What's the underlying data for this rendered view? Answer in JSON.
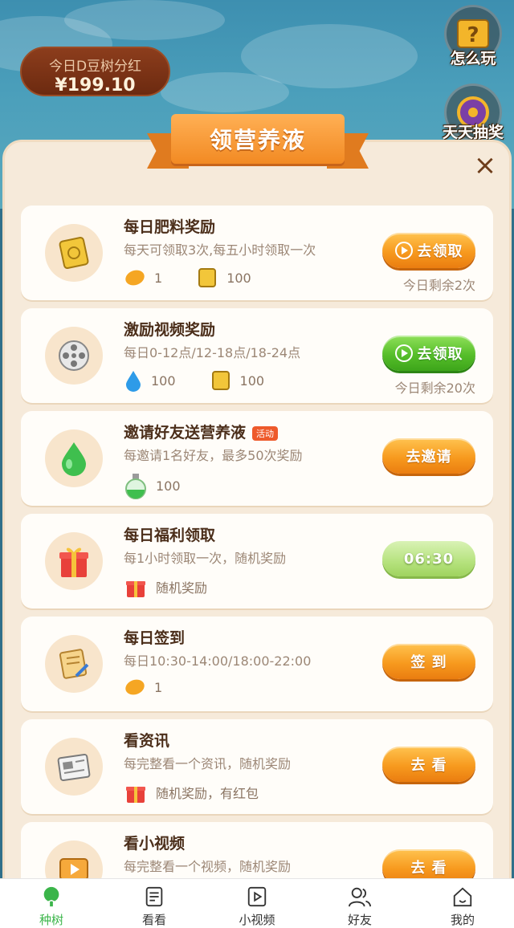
{
  "header": {
    "dividend_label": "今日D豆树分红",
    "dividend_amount": "¥199.10",
    "how_to_play": "怎么玩",
    "daily_lottery": "天天抽奖"
  },
  "panel": {
    "title": "领营养液",
    "close_icon": "×"
  },
  "tasks": [
    {
      "title": "每日肥料奖励",
      "desc": "每天可领取3次,每五小时领取一次",
      "rewards": [
        {
          "icon": "bean-icon",
          "value": "1"
        },
        {
          "icon": "fertilizer-bag-icon",
          "value": "100"
        }
      ],
      "button": "去领取",
      "button_style": "orange-play",
      "remain": "今日剩余2次"
    },
    {
      "title": "激励视频奖励",
      "desc": "每日0-12点/12-18点/18-24点",
      "rewards": [
        {
          "icon": "water-drop-icon",
          "value": "100"
        },
        {
          "icon": "fertilizer-bag-icon",
          "value": "100"
        }
      ],
      "button": "去领取",
      "button_style": "green-play",
      "remain": "今日剩余20次"
    },
    {
      "title": "邀请好友送营养液",
      "tag": "活动",
      "desc": "每邀请1名好友，最多50次奖励",
      "rewards": [
        {
          "icon": "nutrient-bottle-icon",
          "value": "100"
        }
      ],
      "button": "去邀请",
      "button_style": "orange"
    },
    {
      "title": "每日福利领取",
      "desc": "每1小时领取一次，随机奖励",
      "rewards": [
        {
          "icon": "gift-icon",
          "value": "随机奖励"
        }
      ],
      "button": "06:30",
      "button_style": "light-green"
    },
    {
      "title": "每日签到",
      "desc": "每日10:30-14:00/18:00-22:00",
      "rewards": [
        {
          "icon": "bean-icon",
          "value": "1"
        }
      ],
      "button": "签 到",
      "button_style": "orange"
    },
    {
      "title": "看资讯",
      "desc": "每完整看一个资讯，随机奖励",
      "rewards": [
        {
          "icon": "gift-icon",
          "value": "随机奖励，有红包"
        }
      ],
      "button": "去 看",
      "button_style": "orange"
    },
    {
      "title": "看小视频",
      "desc": "每完整看一个视频，随机奖励",
      "button": "去 看",
      "button_style": "orange"
    }
  ],
  "nav": [
    {
      "label": "种树",
      "icon": "tree-icon",
      "active": true
    },
    {
      "label": "看看",
      "icon": "article-icon"
    },
    {
      "label": "小视频",
      "icon": "video-icon"
    },
    {
      "label": "好友",
      "icon": "friends-icon"
    },
    {
      "label": "我的",
      "icon": "home-icon"
    }
  ],
  "colors": {
    "accent_orange": "#f79a1e",
    "accent_green": "#56be2a",
    "nav_active": "#3bb54a",
    "panel_bg": "#f6eada"
  }
}
